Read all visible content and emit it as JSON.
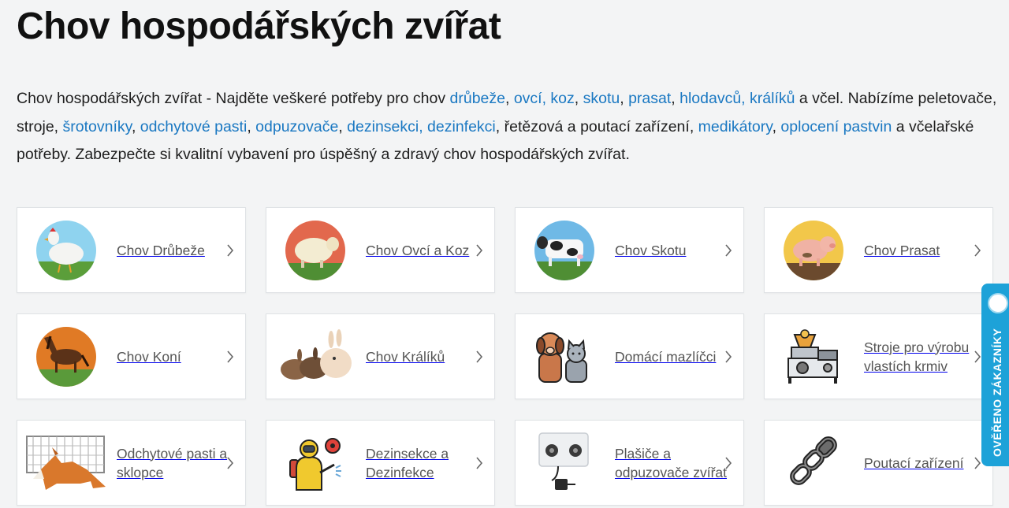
{
  "page": {
    "title": "Chov hospodářských zvířat"
  },
  "intro": {
    "t1": "Chov hospodářských zvířat - Najděte veškeré potřeby pro chov ",
    "l_drubeze": "drůbeže",
    "s1": ", ",
    "l_ovci": "ovcí, koz",
    "s2": ", ",
    "l_skotu": "skotu",
    "s3": ", ",
    "l_prasat": "prasat",
    "s4": ", ",
    "l_hlodavcu": "hlodavců, králíků",
    "t2": " a včel. Nabízíme peletovače, stroje, ",
    "l_srotovniky": "šrotovníky",
    "s5": ", ",
    "l_pasti": "odchytové pasti",
    "s6": ", ",
    "l_odpuzovace": "odpuzovače",
    "s7": ", ",
    "l_dezinsekci": "dezinsekci, dezinfekci",
    "t3": ", řetězová a poutací zařízení, ",
    "l_medikatory": "medikátory",
    "s8": ", ",
    "l_oploceni": "oplocení pastvin",
    "t4": " a včelařské potřeby. Zabezpečte si kvalitní vybavení pro úspěšný a zdravý chov hospodářských zvířat."
  },
  "categories": [
    {
      "label": "Chov Drůbeže",
      "icon": "chicken-icon"
    },
    {
      "label": "Chov Ovcí a Koz",
      "icon": "sheep-icon"
    },
    {
      "label": "Chov Skotu",
      "icon": "cow-icon"
    },
    {
      "label": "Chov Prasat",
      "icon": "pig-icon"
    },
    {
      "label": "Chov Koní",
      "icon": "horse-icon"
    },
    {
      "label": "Chov Králíků",
      "icon": "rabbit-icon"
    },
    {
      "label": "Domácí mazlíčci",
      "icon": "pets-icon"
    },
    {
      "label": "Stroje pro výrobu vlastích krmiv",
      "icon": "feed-machine-icon"
    },
    {
      "label": "Odchytové pasti a sklopce",
      "icon": "trap-icon"
    },
    {
      "label": "Dezinsekce a Dezinfekce",
      "icon": "disinfection-icon"
    },
    {
      "label": "Plašiče a odpuzovače zvířat",
      "icon": "repeller-icon"
    },
    {
      "label": "Poutací zařízení",
      "icon": "chain-icon"
    }
  ],
  "badge": {
    "text": "OVĚŘENO ZÁKAZNÍKY",
    "color": "#1da2d8"
  },
  "colors": {
    "link": "#1a78c2",
    "card_text": "#555555"
  }
}
